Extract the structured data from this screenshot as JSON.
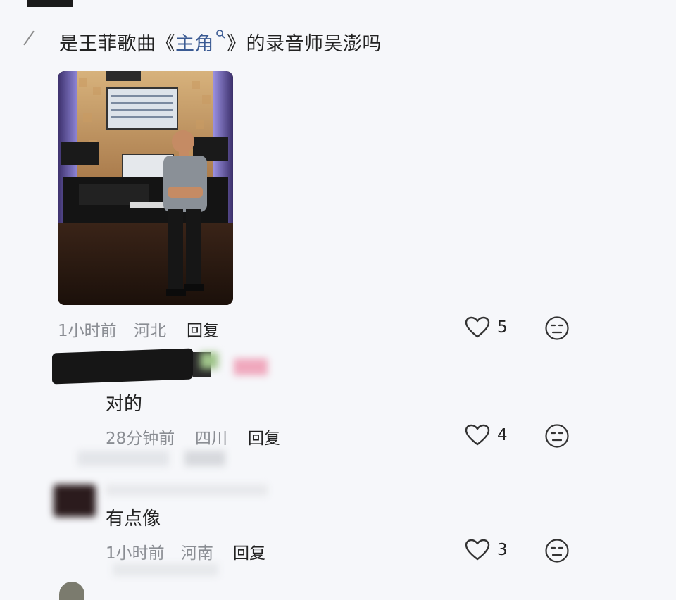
{
  "main_comment": {
    "text_before": "是王菲歌曲《",
    "song_title": "主角",
    "text_after": "》的录音师吴澎吗",
    "time": "1小时前",
    "location": "河北",
    "reply_label": "回复",
    "likes": "5"
  },
  "replies": [
    {
      "text": "对的",
      "time": "28分钟前",
      "location": "四川",
      "reply_label": "回复",
      "likes": "4"
    },
    {
      "text": "有点像",
      "time": "1小时前",
      "location": "河南",
      "reply_label": "回复",
      "likes": "3"
    }
  ],
  "icons": [
    "heart-icon",
    "dislike-face-icon",
    "search-icon"
  ],
  "colors": {
    "link": "#3a5a93",
    "meta": "#8a8d93",
    "background": "#f6f7fa"
  }
}
